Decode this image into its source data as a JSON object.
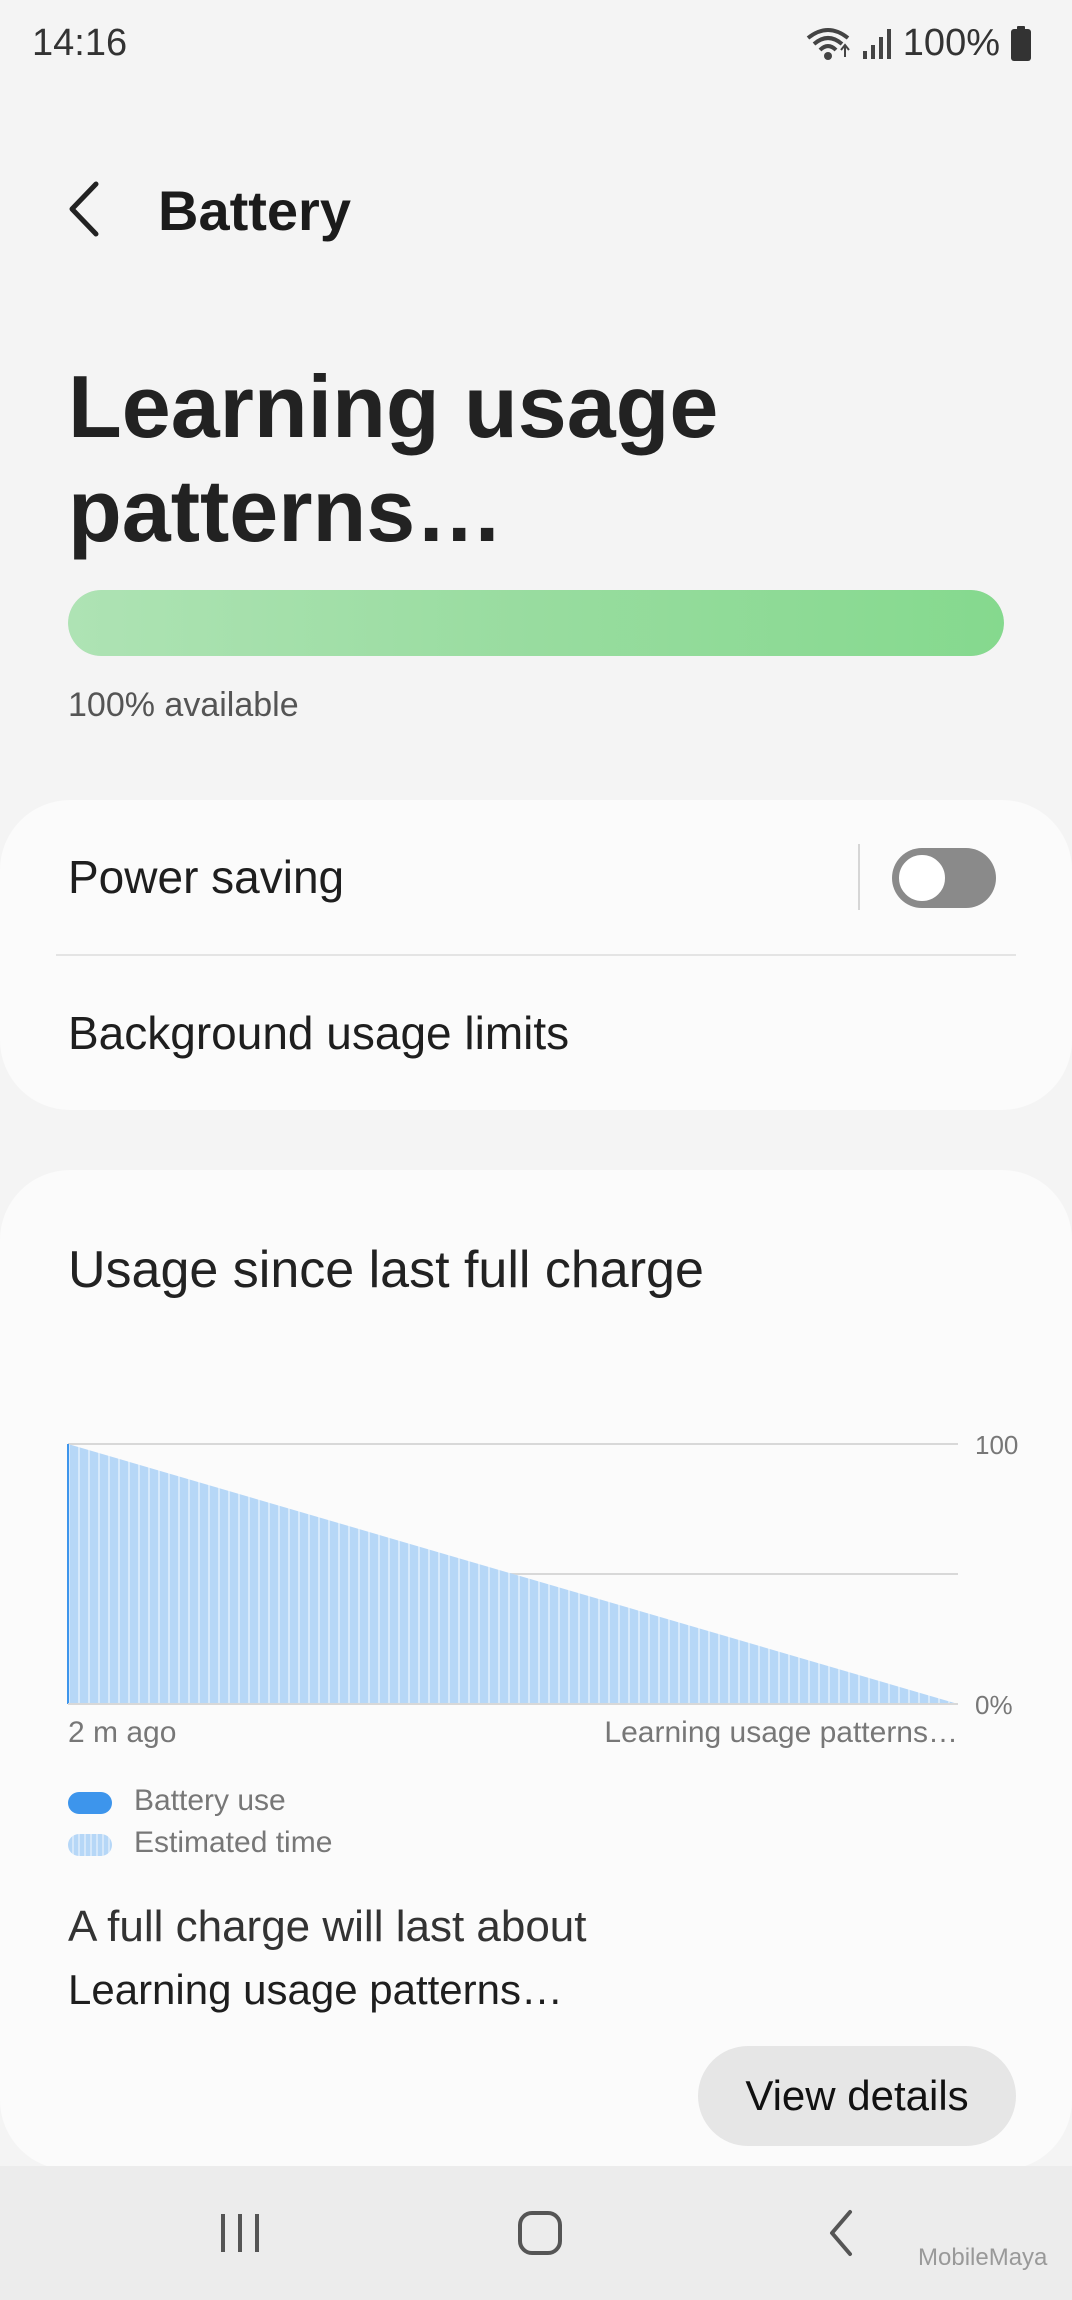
{
  "status_bar": {
    "time": "14:16",
    "battery_percent": "100%"
  },
  "header": {
    "title": "Battery"
  },
  "hero": {
    "title": "Learning usage patterns…",
    "battery_level": 100,
    "available_text": "100% available"
  },
  "settings": {
    "power_saving_label": "Power saving",
    "power_saving_enabled": false,
    "background_limits_label": "Background usage limits"
  },
  "usage": {
    "title": "Usage since last full charge",
    "chart_data": {
      "type": "area",
      "x_labels": [
        "2 m ago",
        "Learning usage patterns…"
      ],
      "y_ticks": [
        "100",
        "0%"
      ],
      "ylim": [
        0,
        100
      ],
      "grid": true,
      "series": [
        {
          "name": "Battery use",
          "x": [
            0
          ],
          "y": [
            100
          ]
        },
        {
          "name": "Estimated time",
          "x": [
            0,
            1
          ],
          "y": [
            100,
            0
          ]
        }
      ],
      "legend": [
        "Battery use",
        "Estimated time"
      ],
      "legend_position": "bottom-left"
    },
    "full_charge_label": "A full charge will last about",
    "full_charge_value": "Learning usage patterns…",
    "view_details_label": "View details"
  },
  "colors": {
    "accent_blue": "#3d95ec",
    "estimate_blue": "#b6d7f7",
    "battery_green": "#85d98e",
    "toggle_off": "#8a8a8a"
  },
  "icons": [
    "wifi-icon",
    "signal-icon",
    "battery-icon",
    "back-arrow-icon",
    "recents-icon",
    "home-icon",
    "nav-back-icon"
  ],
  "watermark": "MobileMaya"
}
